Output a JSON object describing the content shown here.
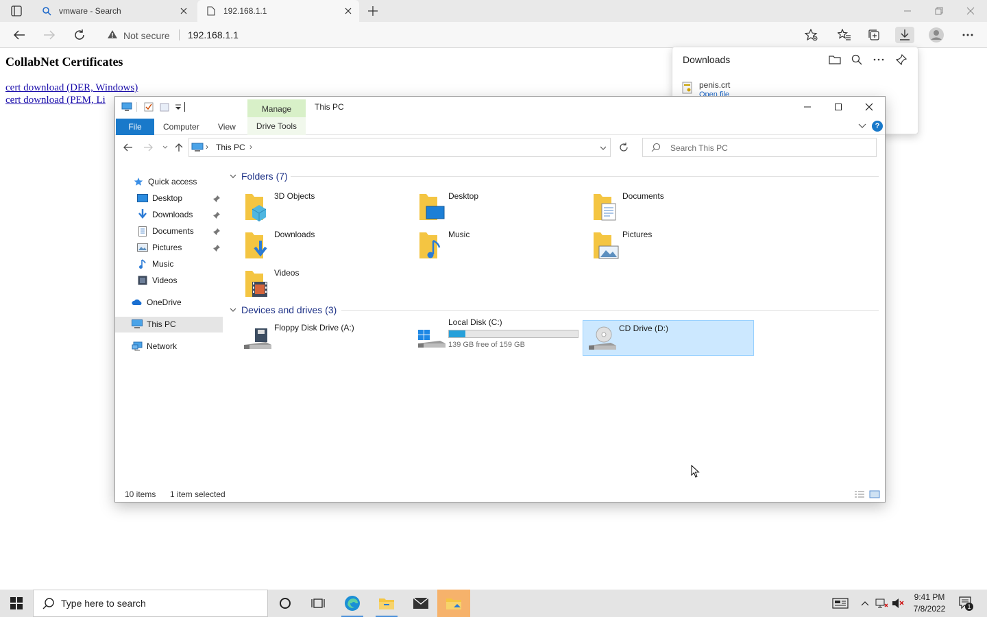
{
  "browser": {
    "tabs": [
      {
        "title": "vmware - Search",
        "icon": "search-icon"
      },
      {
        "title": "192.168.1.1",
        "icon": "page-icon"
      }
    ],
    "security_label": "Not secure",
    "url": "192.168.1.1"
  },
  "page": {
    "heading": "CollabNet Certificates",
    "links": [
      "cert download (DER, Windows)",
      "cert download (PEM, Li"
    ]
  },
  "downloads": {
    "title": "Downloads",
    "file_name": "penis.crt",
    "file_action": "Open file"
  },
  "explorer": {
    "title": "This PC",
    "manage_label": "Manage",
    "ribbon_tabs": {
      "file": "File",
      "computer": "Computer",
      "view": "View",
      "drive_tools": "Drive Tools"
    },
    "breadcrumb": "This PC",
    "search_placeholder": "Search This PC",
    "nav": {
      "quick_access": "Quick access",
      "desktop": "Desktop",
      "downloads": "Downloads",
      "documents": "Documents",
      "pictures": "Pictures",
      "music": "Music",
      "videos": "Videos",
      "onedrive": "OneDrive",
      "this_pc": "This PC",
      "network": "Network"
    },
    "folders_header": "Folders (7)",
    "folders": [
      "3D Objects",
      "Desktop",
      "Documents",
      "Downloads",
      "Music",
      "Pictures",
      "Videos"
    ],
    "drives_header": "Devices and drives (3)",
    "drives": {
      "floppy": "Floppy Disk Drive (A:)",
      "local": "Local Disk (C:)",
      "local_free": "139 GB free of 159 GB",
      "local_used_fraction": 0.126,
      "cd": "CD Drive (D:)"
    },
    "status": {
      "items": "10 items",
      "selected": "1 item selected"
    }
  },
  "taskbar": {
    "search_placeholder": "Type here to search",
    "time": "9:41 PM",
    "date": "7/8/2022",
    "notification_count": "1"
  },
  "colors": {
    "accent": "#1979ca",
    "selection": "#cce8ff",
    "drive_fill": "#26a0da",
    "manage_tab": "#d8f0c8",
    "link": "#1a0dab"
  }
}
